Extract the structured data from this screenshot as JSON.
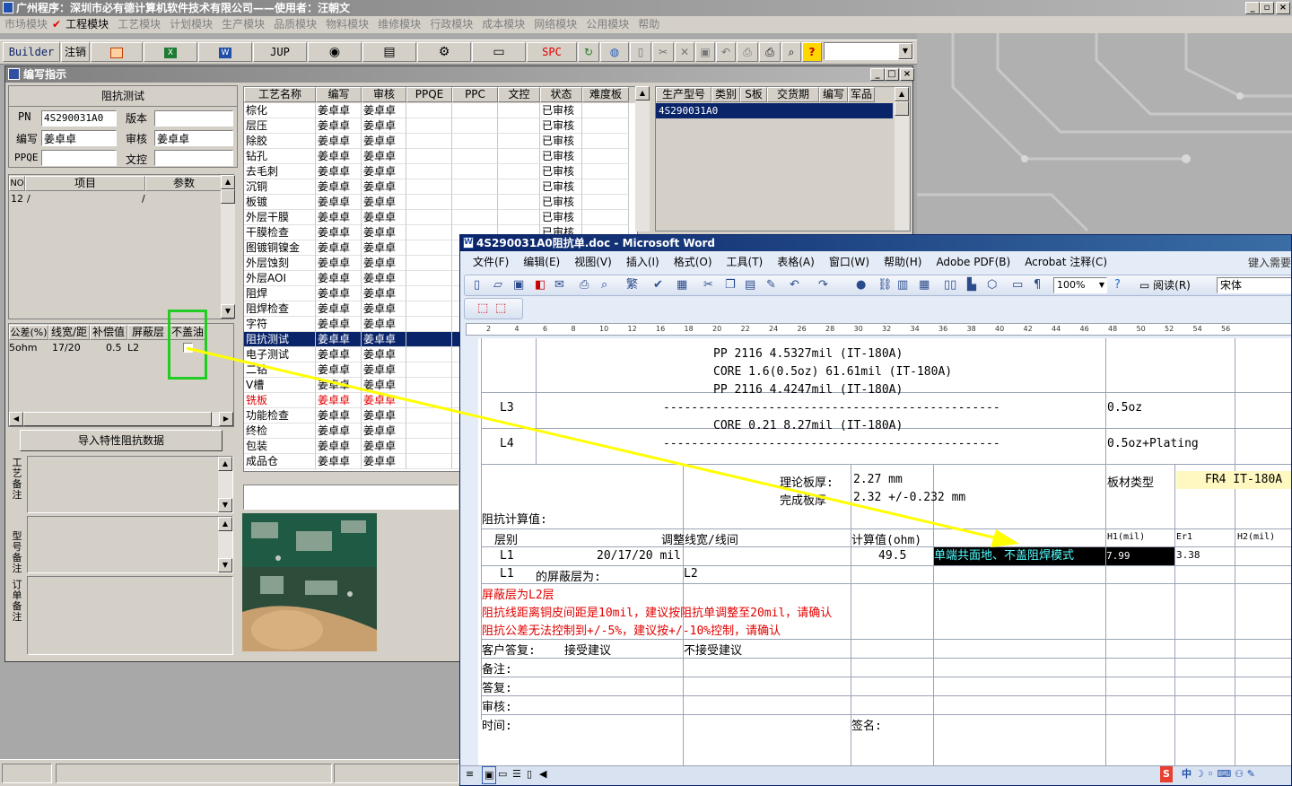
{
  "app": {
    "title": "广州程序：深圳市必有德计算机软件技术有限公司——使用者：汪朝文",
    "menu": [
      "市场模块",
      "工程模块",
      "工艺模块",
      "计划模块",
      "生产模块",
      "品质模块",
      "物料模块",
      "维修模块",
      "行政模块",
      "成本模块",
      "网络模块",
      "公用模块",
      "帮助"
    ],
    "toolbar": {
      "builder": "Builder",
      "logout": "注销",
      "jup": "JUP",
      "spc": "SPC",
      "combo_value": ""
    }
  },
  "panel": {
    "title": "编写指示",
    "section_title": "阻抗测试",
    "pn_label": "PN",
    "pn_value": "4S290031A0",
    "version_label": "版本",
    "version_value": "",
    "writer_label": "编写",
    "writer_value": "姜卓卓",
    "auditor_label": "审核",
    "auditor_value": "姜卓卓",
    "ppqe_label": "PPQE",
    "ppqe_value": "",
    "doc_label": "文控",
    "doc_value": "",
    "items_headers": [
      "NO",
      "项目",
      "参数"
    ],
    "items_rows": [
      [
        "12",
        "/",
        "/"
      ]
    ],
    "imp_headers": [
      "公差(%)",
      "线宽/距",
      "补偿值",
      "屏蔽层",
      "不盖油"
    ],
    "imp_rows": [
      [
        "5ohm",
        "17/20",
        "0.5",
        "L2",
        ""
      ]
    ],
    "import_button": "导入特性阻抗数据",
    "note_labels": [
      "工艺备注",
      "型号备注",
      "订单备注"
    ]
  },
  "process": {
    "headers": [
      "工艺名称",
      "编写",
      "审核",
      "PPQE",
      "PPC",
      "文控",
      "状态",
      "难度板"
    ],
    "rows": [
      [
        "棕化",
        "姜卓卓",
        "姜卓卓",
        "",
        "",
        "",
        "已审核"
      ],
      [
        "层压",
        "姜卓卓",
        "姜卓卓",
        "",
        "",
        "",
        "已审核"
      ],
      [
        "除胶",
        "姜卓卓",
        "姜卓卓",
        "",
        "",
        "",
        "已审核"
      ],
      [
        "钻孔",
        "姜卓卓",
        "姜卓卓",
        "",
        "",
        "",
        "已审核"
      ],
      [
        "去毛刺",
        "姜卓卓",
        "姜卓卓",
        "",
        "",
        "",
        "已审核"
      ],
      [
        "沉铜",
        "姜卓卓",
        "姜卓卓",
        "",
        "",
        "",
        "已审核"
      ],
      [
        "板镀",
        "姜卓卓",
        "姜卓卓",
        "",
        "",
        "",
        "已审核"
      ],
      [
        "外层干膜",
        "姜卓卓",
        "姜卓卓",
        "",
        "",
        "",
        "已审核"
      ],
      [
        "干膜检查",
        "姜卓卓",
        "姜卓卓",
        "",
        "",
        "",
        "已审核"
      ],
      [
        "图镀铜镍金",
        "姜卓卓",
        "姜卓卓",
        "",
        "",
        "",
        ""
      ],
      [
        "外层蚀刻",
        "姜卓卓",
        "姜卓卓",
        "",
        "",
        "",
        ""
      ],
      [
        "外层AOI",
        "姜卓卓",
        "姜卓卓",
        "",
        "",
        "",
        ""
      ],
      [
        "阻焊",
        "姜卓卓",
        "姜卓卓",
        "",
        "",
        "",
        ""
      ],
      [
        "阻焊检查",
        "姜卓卓",
        "姜卓卓",
        "",
        "",
        "",
        ""
      ],
      [
        "字符",
        "姜卓卓",
        "姜卓卓",
        "",
        "",
        "",
        ""
      ],
      [
        "阻抗测试",
        "姜卓卓",
        "姜卓卓",
        "",
        "",
        "",
        ""
      ],
      [
        "电子测试",
        "姜卓卓",
        "姜卓卓",
        "",
        "",
        "",
        ""
      ],
      [
        "二钻",
        "姜卓卓",
        "姜卓卓",
        "",
        "",
        "",
        ""
      ],
      [
        "V槽",
        "姜卓卓",
        "姜卓卓",
        "",
        "",
        "",
        ""
      ],
      [
        "铣板",
        "姜卓卓",
        "姜卓卓",
        "",
        "",
        "",
        ""
      ],
      [
        "功能检查",
        "姜卓卓",
        "姜卓卓",
        "",
        "",
        "",
        ""
      ],
      [
        "终检",
        "姜卓卓",
        "姜卓卓",
        "",
        "",
        "",
        ""
      ],
      [
        "包装",
        "姜卓卓",
        "姜卓卓",
        "",
        "",
        "",
        ""
      ],
      [
        "成品仓",
        "姜卓卓",
        "姜卓卓",
        "",
        "",
        "",
        ""
      ]
    ],
    "selected_index": 15,
    "red_index": 19
  },
  "production": {
    "headers": [
      "生产型号",
      "类别",
      "S板",
      "交货期",
      "编写",
      "军品"
    ],
    "rows": [
      [
        "4S290031A0",
        "",
        "",
        "",
        "",
        ""
      ]
    ]
  },
  "word": {
    "title": "4S290031A0阻抗单.doc - Microsoft Word",
    "menu": [
      "文件(F)",
      "编辑(E)",
      "视图(V)",
      "插入(I)",
      "格式(O)",
      "工具(T)",
      "表格(A)",
      "窗口(W)",
      "帮助(H)",
      "Adobe PDF(B)",
      "Acrobat 注释(C)"
    ],
    "help_prompt": "键入需要",
    "zoom": "100%",
    "read_label": "阅读(R)",
    "font_name": "宋体",
    "ruler": [
      "2",
      "4",
      "6",
      "8",
      "10",
      "12",
      "16",
      "18",
      "20",
      "22",
      "24",
      "26",
      "28",
      "30",
      "32",
      "34",
      "36",
      "38",
      "40",
      "42",
      "44",
      "46",
      "48",
      "50",
      "52",
      "54",
      "56"
    ],
    "stack": [
      {
        "layer": "",
        "text": "PP  2116  4.5327mil  (IT-180A)",
        "right": ""
      },
      {
        "layer": "",
        "text": "CORE  1.6(0.5oz)  61.61mil  (IT-180A)",
        "right": ""
      },
      {
        "layer": "",
        "text": "PP  2116  4.4247mil  (IT-180A)",
        "right": ""
      },
      {
        "layer": "L3",
        "text": "------------------------------------------------",
        "right": "0.5oz"
      },
      {
        "layer": "",
        "text": "CORE  0.21  8.27mil  (IT-180A)",
        "right": ""
      },
      {
        "layer": "L4",
        "text": "------------------------------------------------",
        "right": "0.5oz+Plating"
      }
    ],
    "theory_label": "理论板厚:",
    "theory_value": "2.27 mm",
    "material_label": "板材类型",
    "material_value": "FR4  IT-180A",
    "finish_label": "完成板厚",
    "finish_value": "2.32 +/-0.232 mm",
    "calc_title": "阻抗计算值:",
    "calc_headers": [
      "层别",
      "调整线宽/线间",
      "计算值(ohm)",
      "H1(mil)",
      "Er1",
      "H2(mil)"
    ],
    "calc_row": [
      "L1",
      "20/17/20 mil",
      "49.5",
      "单端共面地、不盖阻焊模式",
      "7.99",
      "3.38"
    ],
    "shield_row": [
      "L1",
      "的屏蔽层为:",
      "L2"
    ],
    "red_lines": [
      "屏蔽层为L2层",
      "阻抗线距离铜皮间距是10mil，建议按阻抗单调整至20mil，请确认",
      "阻抗公差无法控制到+/-5%，建议按+/-10%控制，请确认"
    ],
    "reply_label": "客户答复:",
    "accept": "接受建议",
    "reject": "不接受建议",
    "footer_labels": [
      "备注:",
      "答复:",
      "审核:",
      "时间:"
    ],
    "sign_label": "签名:"
  }
}
